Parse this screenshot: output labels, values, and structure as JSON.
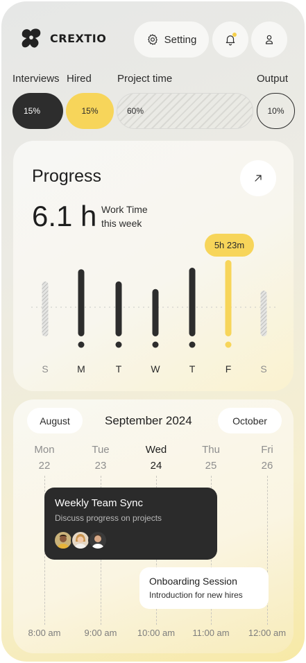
{
  "header": {
    "brand": "CREXTIO",
    "setting_label": "Setting"
  },
  "stats": {
    "interviews": {
      "label": "Interviews",
      "value": "15%"
    },
    "hired": {
      "label": "Hired",
      "value": "15%"
    },
    "project_time": {
      "label": "Project time",
      "value": "60%"
    },
    "output": {
      "label": "Output",
      "value": "10%"
    }
  },
  "progress": {
    "title": "Progress",
    "hours": "6.1 h",
    "caption_line1": "Work Time",
    "caption_line2": "this week",
    "tooltip": "5h 23m"
  },
  "chart_data": {
    "type": "bar",
    "categories": [
      "S",
      "M",
      "T",
      "W",
      "T",
      "F",
      "S"
    ],
    "values": [
      0.72,
      0.88,
      0.72,
      0.62,
      0.9,
      1.0,
      0.6
    ],
    "highlight_index": 5,
    "muted_indices": [
      0,
      6
    ],
    "colors": {
      "bar": "#2d2d2d",
      "highlight": "#f7d55a",
      "muted": "#c8c8c8"
    }
  },
  "calendar": {
    "prev_month": "August",
    "current_month": "September 2024",
    "next_month": "October",
    "days": [
      {
        "name": "Mon",
        "num": "22"
      },
      {
        "name": "Tue",
        "num": "23"
      },
      {
        "name": "Wed",
        "num": "24"
      },
      {
        "name": "Thu",
        "num": "25"
      },
      {
        "name": "Fri",
        "num": "26"
      }
    ],
    "active_day_index": 2,
    "times": [
      "8:00 am",
      "9:00 am",
      "10:00 am",
      "11:00 am",
      "12:00 am"
    ],
    "events": [
      {
        "title": "Weekly Team Sync",
        "subtitle": "Discuss progress on projects"
      },
      {
        "title": "Onboarding Session",
        "subtitle": "Introduction for new hires"
      }
    ]
  },
  "colors": {
    "accent": "#f7d55a",
    "dark": "#2d2d2d"
  }
}
